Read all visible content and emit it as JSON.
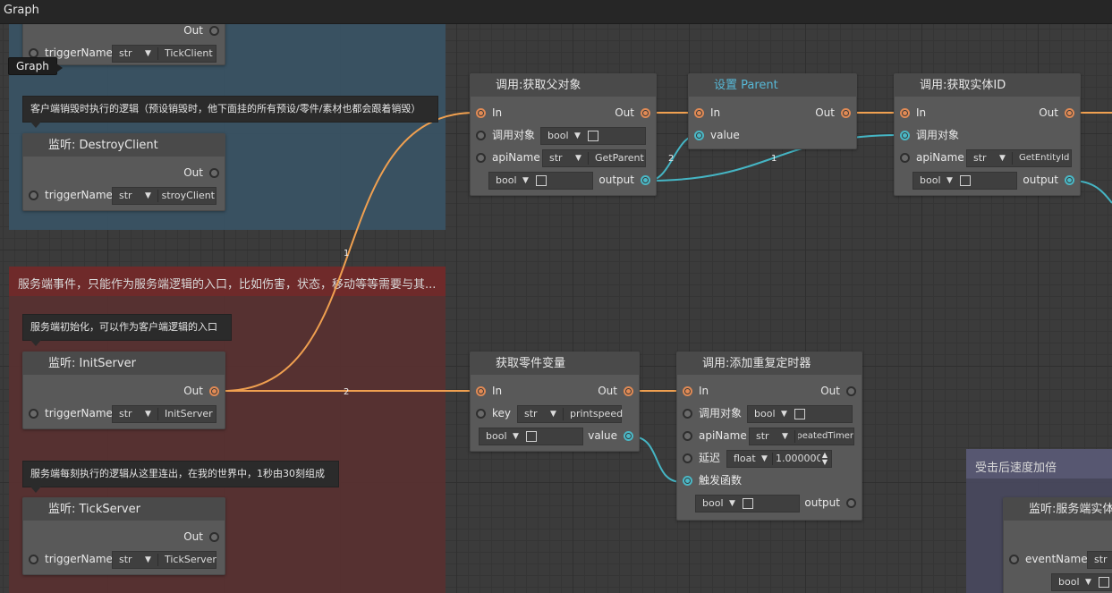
{
  "window": {
    "title": "Graph",
    "tooltip": "Graph"
  },
  "groups": {
    "client": {
      "title": ""
    },
    "server": {
      "title": "服务端事件，只能作为服务端逻辑的入口，比如伤害，状态，移动等等需要与其..."
    },
    "hit": {
      "title": "受击后速度加倍"
    }
  },
  "comments": {
    "destroy_client": "客户端销毁时执行的逻辑（预设销毁时，他下面挂的所有预设/零件/素材也都会跟着销毁）",
    "init_server": "服务端初始化，可以作为客户端逻辑的入口",
    "tick_server": "服务端每刻执行的逻辑从这里连出，在我的世界中，1秒由30刻组成"
  },
  "common": {
    "out": "Out",
    "in": "In",
    "trigger_name": "triggerName",
    "api_name": "apiName",
    "call_target": "调用对象",
    "output": "output",
    "value": "value",
    "key": "key",
    "type_str": "str",
    "type_bool": "bool",
    "type_float": "float",
    "event_name": "eventName"
  },
  "nodes": {
    "tick_client": {
      "trigger_value": "TickClient"
    },
    "destroy_client": {
      "title": "监听: DestroyClient",
      "trigger_value": "DestroyClient"
    },
    "init_server": {
      "title": "监听: InitServer",
      "trigger_value": "InitServer"
    },
    "tick_server": {
      "title": "监听: TickServer",
      "trigger_value": "TickServer"
    },
    "get_parent": {
      "title": "调用:获取父对象",
      "api_value": "GetParent"
    },
    "set_parent": {
      "title": "设置 Parent"
    },
    "get_entity_id": {
      "title": "调用:获取实体ID",
      "api_value": "GetEntityId"
    },
    "get_part_var": {
      "title": "获取零件变量",
      "key_value": "printspeed"
    },
    "add_timer": {
      "title": "调用:添加重复定时器",
      "api_value": "RepeatedTimer",
      "delay_label": "延迟",
      "delay_value": "1.0000000",
      "trigger_func": "触发函数"
    },
    "listen_server_entity": {
      "title": "监听:服务端实体"
    }
  },
  "edge_labels": {
    "e1": "1",
    "e2": "2",
    "e3": "2",
    "e4": "1"
  },
  "colors": {
    "exec_wire": "#f0a050",
    "data_wire": "#45b5c4",
    "client_group": "#3a5466",
    "server_group": "#5a2f2f",
    "hit_group": "#4a4a62",
    "accent_title": "#57b8d6"
  }
}
